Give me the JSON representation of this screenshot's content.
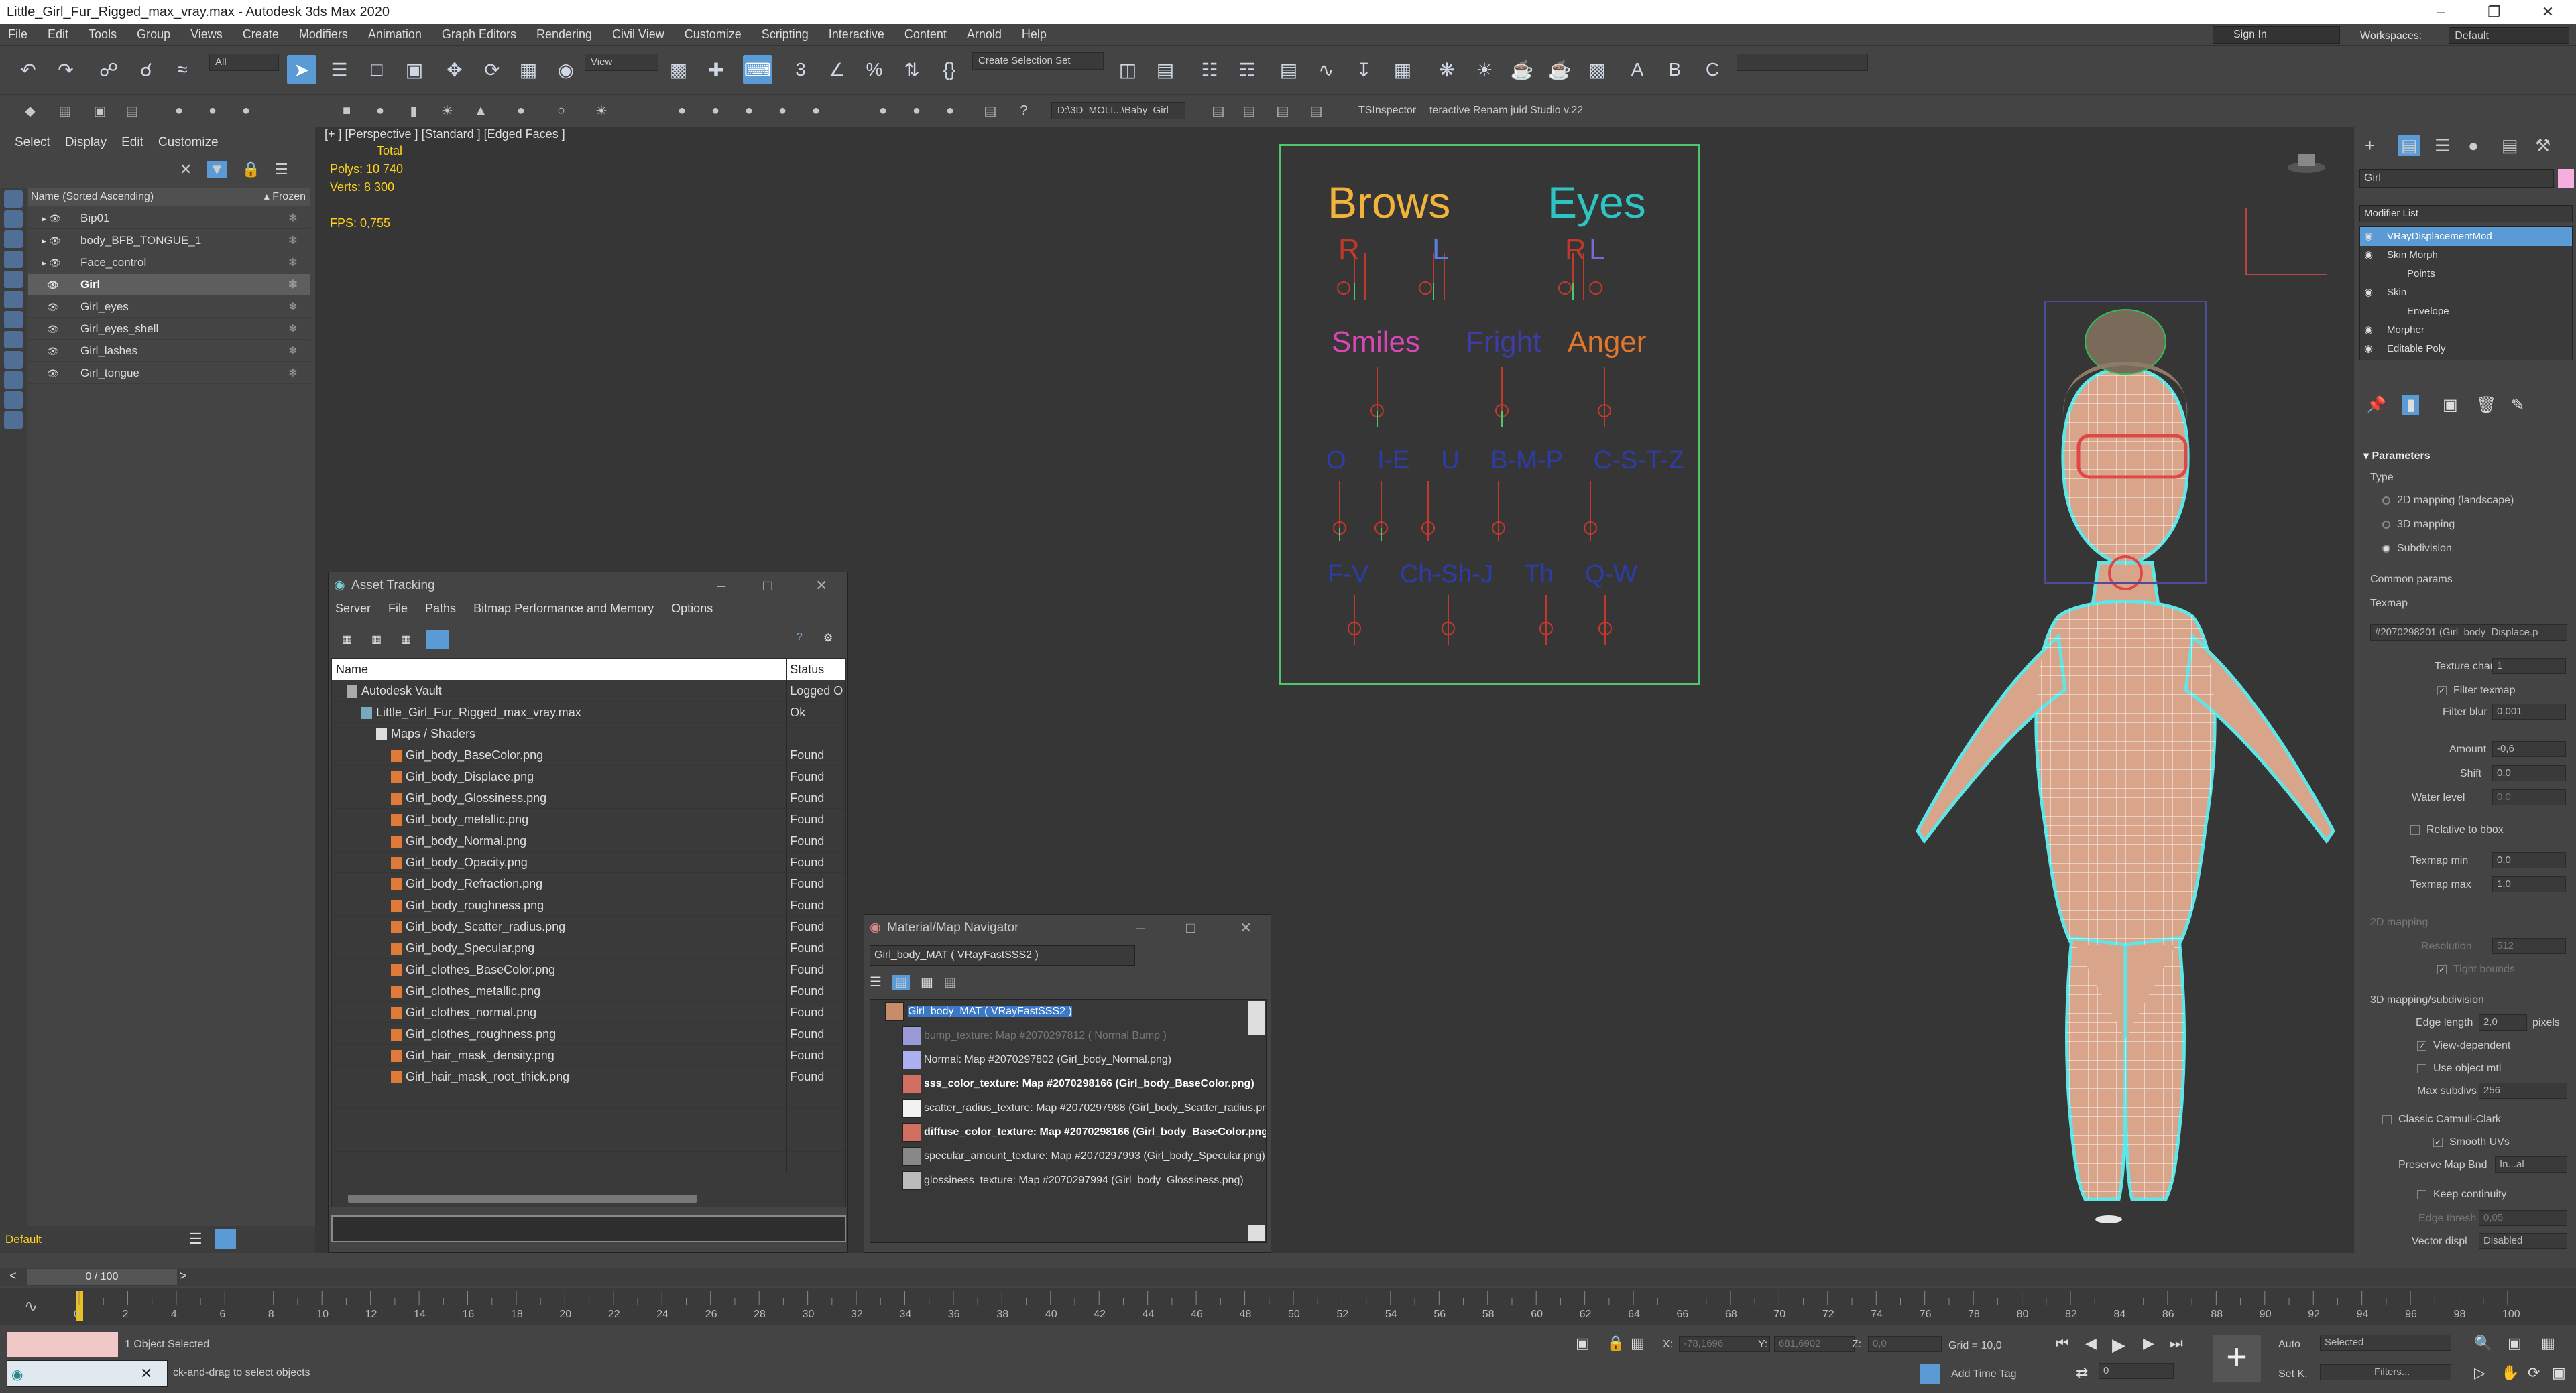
{
  "window": {
    "title": "Little_Girl_Fur_Rigged_max_vray.max - Autodesk 3ds Max 2020",
    "sign_in": "Sign In",
    "workspaces_label": "Workspaces:",
    "workspace_value": "Default"
  },
  "menu": [
    "File",
    "Edit",
    "Tools",
    "Group",
    "Views",
    "Create",
    "Modifiers",
    "Animation",
    "Graph Editors",
    "Rendering",
    "Civil View",
    "Customize",
    "Scripting",
    "Interactive",
    "Content",
    "Arnold",
    "Help"
  ],
  "toolbar": {
    "filter_value": "All",
    "refcoord_value": "View",
    "selection_set_placeholder": "Create Selection Set",
    "project_path": "D:\\3D_MOLI...\\Baby_Girl",
    "ts_inspector": "TSInspector",
    "renamer": "teractive Renam juid Studio v.22"
  },
  "scene_explorer": {
    "tabs": [
      "Select",
      "Display",
      "Edit",
      "Customize"
    ],
    "header": "Name (Sorted Ascending)",
    "frozen_label": "▴ Frozen",
    "items": [
      {
        "name": "Bip01",
        "selected": false
      },
      {
        "name": "body_BFB_TONGUE_1",
        "selected": false
      },
      {
        "name": "Face_control",
        "selected": false
      },
      {
        "name": "Girl",
        "selected": true
      },
      {
        "name": "Girl_eyes",
        "selected": false
      },
      {
        "name": "Girl_eyes_shell",
        "selected": false
      },
      {
        "name": "Girl_lashes",
        "selected": false
      },
      {
        "name": "Girl_tongue",
        "selected": false
      }
    ],
    "layer": "Default"
  },
  "viewport": {
    "label": "[+ ] [Perspective ] [Standard ] [Edged Faces ]",
    "total_label": "Total",
    "polys": "Polys:   10 740",
    "verts": "Verts:   8 300",
    "fps": "FPS:     0,755",
    "board": {
      "brows": "Brows",
      "eyes": "Eyes",
      "r1": "R",
      "l1": "L",
      "r2": "R",
      "l2": "L",
      "smiles": "Smiles",
      "fright": "Fright",
      "anger": "Anger",
      "row3": [
        "O",
        "I-E",
        "U",
        "B-M-P",
        "C-S-T-Z"
      ],
      "row4": [
        "F-V",
        "Ch-Sh-J",
        "Th",
        "Q-W"
      ]
    }
  },
  "asset_tracking": {
    "title": "Asset Tracking",
    "menu": [
      "Server",
      "File",
      "Paths",
      "Bitmap Performance and Memory",
      "Options"
    ],
    "col_name": "Name",
    "col_status": "Status",
    "rows": [
      {
        "name": "Autodesk Vault",
        "status": "Logged O",
        "indent": 1,
        "icon": "vault"
      },
      {
        "name": "Little_Girl_Fur_Rigged_max_vray.max",
        "status": "Ok",
        "indent": 2,
        "icon": "max"
      },
      {
        "name": "Maps / Shaders",
        "status": "",
        "indent": 3,
        "icon": "folder"
      },
      {
        "name": "Girl_body_BaseColor.png",
        "status": "Found",
        "indent": 4,
        "icon": "file"
      },
      {
        "name": "Girl_body_Displace.png",
        "status": "Found",
        "indent": 4,
        "icon": "file"
      },
      {
        "name": "Girl_body_Glossiness.png",
        "status": "Found",
        "indent": 4,
        "icon": "file"
      },
      {
        "name": "Girl_body_metallic.png",
        "status": "Found",
        "indent": 4,
        "icon": "file"
      },
      {
        "name": "Girl_body_Normal.png",
        "status": "Found",
        "indent": 4,
        "icon": "file"
      },
      {
        "name": "Girl_body_Opacity.png",
        "status": "Found",
        "indent": 4,
        "icon": "file"
      },
      {
        "name": "Girl_body_Refraction.png",
        "status": "Found",
        "indent": 4,
        "icon": "file"
      },
      {
        "name": "Girl_body_roughness.png",
        "status": "Found",
        "indent": 4,
        "icon": "file"
      },
      {
        "name": "Girl_body_Scatter_radius.png",
        "status": "Found",
        "indent": 4,
        "icon": "file"
      },
      {
        "name": "Girl_body_Specular.png",
        "status": "Found",
        "indent": 4,
        "icon": "file"
      },
      {
        "name": "Girl_clothes_BaseColor.png",
        "status": "Found",
        "indent": 4,
        "icon": "file"
      },
      {
        "name": "Girl_clothes_metallic.png",
        "status": "Found",
        "indent": 4,
        "icon": "file"
      },
      {
        "name": "Girl_clothes_normal.png",
        "status": "Found",
        "indent": 4,
        "icon": "file"
      },
      {
        "name": "Girl_clothes_roughness.png",
        "status": "Found",
        "indent": 4,
        "icon": "file"
      },
      {
        "name": "Girl_hair_mask_density.png",
        "status": "Found",
        "indent": 4,
        "icon": "file"
      },
      {
        "name": "Girl_hair_mask_root_thick.png",
        "status": "Found",
        "indent": 4,
        "icon": "file"
      }
    ]
  },
  "material_navigator": {
    "title": "Material/Map Navigator",
    "current": "Girl_body_MAT  ( VRayFastSSS2 )",
    "rows": [
      {
        "text": "Girl_body_MAT  ( VRayFastSSS2 )",
        "style": "root",
        "swatch": "#c98c6b"
      },
      {
        "text": "bump_texture: Map #2070297812  ( Normal Bump )",
        "style": "dim",
        "swatch": "#9a9ad8"
      },
      {
        "text": "Normal: Map #2070297802 (Girl_body_Normal.png)",
        "style": "normal",
        "swatch": "#aab0f0"
      },
      {
        "text": "sss_color_texture: Map #2070298166 (Girl_body_BaseColor.png)",
        "style": "bold",
        "swatch": "#d07060"
      },
      {
        "text": "scatter_radius_texture: Map #2070297988 (Girl_body_Scatter_radius.png)",
        "style": "normal",
        "swatch": "#f2f2f2"
      },
      {
        "text": "diffuse_color_texture: Map #2070298166 (Girl_body_BaseColor.png)",
        "style": "bold",
        "swatch": "#d07060"
      },
      {
        "text": "specular_amount_texture: Map #2070297993 (Girl_body_Specular.png)",
        "style": "normal",
        "swatch": "#888888"
      },
      {
        "text": "glossiness_texture: Map #2070297994 (Girl_body_Glossiness.png)",
        "style": "normal",
        "swatch": "#bbbbbb"
      }
    ]
  },
  "command_panel": {
    "object_name": "Girl",
    "modifier_list": "Modifier List",
    "stack": [
      {
        "name": "VRayDisplacementMod",
        "level": 0,
        "selected": true
      },
      {
        "name": "Skin Morph",
        "level": 0,
        "selected": false
      },
      {
        "name": "Points",
        "level": 1,
        "selected": false
      },
      {
        "name": "Skin",
        "level": 0,
        "selected": false
      },
      {
        "name": "Envelope",
        "level": 1,
        "selected": false
      },
      {
        "name": "Morpher",
        "level": 0,
        "selected": false
      },
      {
        "name": "Editable Poly",
        "level": 0,
        "selected": false
      }
    ],
    "parameters": "Parameters",
    "type_label": "Type",
    "type_options": [
      "2D mapping (landscape)",
      "3D mapping",
      "Subdivision"
    ],
    "common_params": "Common params",
    "texmap_label": "Texmap",
    "texmap_value": "#2070298201 (Girl_body_Displace.p",
    "texture_chan_label": "Texture chan",
    "texture_chan_value": "1",
    "filter_texmap": "Filter texmap",
    "filter_blur_label": "Filter blur",
    "filter_blur_value": "0,001",
    "amount_label": "Amount",
    "amount_value": "-0,6",
    "shift_label": "Shift",
    "shift_value": "0,0",
    "water_level_label": "Water level",
    "water_level_value": "0,0",
    "relative_bbox": "Relative to bbox",
    "texmap_min_label": "Texmap min",
    "texmap_min_value": "0,0",
    "texmap_max_label": "Texmap max",
    "texmap_max_value": "1,0",
    "mapping_2d": "2D mapping",
    "resolution_label": "Resolution",
    "resolution_value": "512",
    "tight_bounds": "Tight bounds",
    "mapping_3d": "3D mapping/subdivision",
    "edge_length_label": "Edge length",
    "edge_length_value": "2,0",
    "pixels": "pixels",
    "view_dependent": "View-dependent",
    "use_object_mtl": "Use object mtl",
    "max_subdivs_label": "Max subdivs",
    "max_subdivs_value": "256",
    "catmull_clark": "Classic Catmull-Clark",
    "smooth_uvs": "Smooth UVs",
    "preserve_map_label": "Preserve Map Bnd",
    "preserve_map_value": "In...al",
    "keep_continuity": "Keep continuity",
    "edge_thresh_label": "Edge thresh",
    "edge_thresh_value": "0,05",
    "vector_displ_label": "Vector displ",
    "vector_displ_value": "Disabled"
  },
  "timeline": {
    "frame_counter": "0 / 100",
    "ticks": [
      "0",
      "2",
      "4",
      "6",
      "8",
      "10",
      "12",
      "14",
      "16",
      "18",
      "20",
      "22",
      "24",
      "26",
      "28",
      "30",
      "32",
      "34",
      "36",
      "38",
      "40",
      "42",
      "44",
      "46",
      "48",
      "50",
      "52",
      "54",
      "56",
      "58",
      "60",
      "62",
      "64",
      "66",
      "68",
      "70",
      "72",
      "74",
      "76",
      "78",
      "80",
      "82",
      "84",
      "86",
      "88",
      "90",
      "92",
      "94",
      "96",
      "98",
      "100"
    ]
  },
  "status": {
    "selection": "1 Object Selected",
    "prompt": "ck-and-drag to select objects",
    "x_label": "X:",
    "x_value": "-78,1696",
    "y_label": "Y:",
    "y_value": "681,6902",
    "z_label": "Z:",
    "z_value": "0,0",
    "grid": "Grid = 10,0",
    "add_time_tag": "Add Time Tag",
    "auto_label": "Auto",
    "selected_value": "Selected",
    "set_key": "Set K.",
    "filters": "Filters...",
    "frame_value": "0"
  }
}
